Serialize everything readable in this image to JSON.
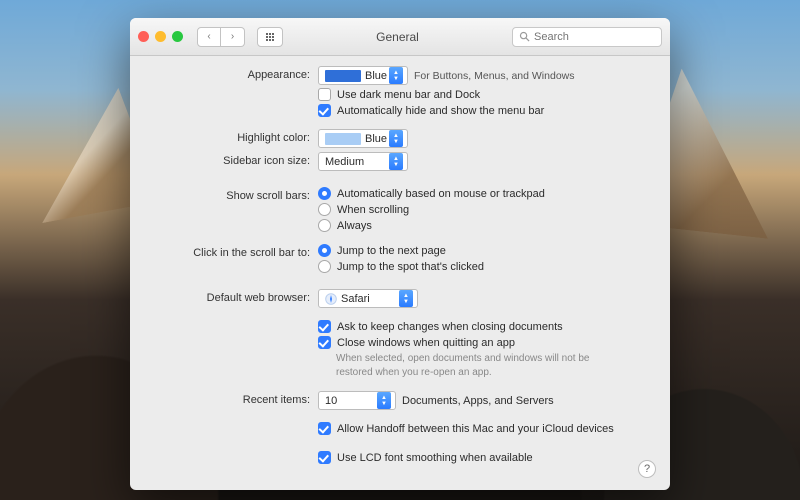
{
  "window": {
    "title": "General"
  },
  "search": {
    "placeholder": "Search"
  },
  "appearance": {
    "label": "Appearance:",
    "value": "Blue",
    "hint": "For Buttons, Menus, and Windows",
    "dark_menu": {
      "label": "Use dark menu bar and Dock",
      "checked": false
    },
    "autohide": {
      "label": "Automatically hide and show the menu bar",
      "checked": true
    }
  },
  "highlight": {
    "label": "Highlight color:",
    "value": "Blue"
  },
  "sidebar": {
    "label": "Sidebar icon size:",
    "value": "Medium"
  },
  "scrollbars": {
    "label": "Show scroll bars:",
    "options": [
      {
        "label": "Automatically based on mouse or trackpad",
        "checked": true
      },
      {
        "label": "When scrolling",
        "checked": false
      },
      {
        "label": "Always",
        "checked": false
      }
    ]
  },
  "click_scroll": {
    "label": "Click in the scroll bar to:",
    "options": [
      {
        "label": "Jump to the next page",
        "checked": true
      },
      {
        "label": "Jump to the spot that's clicked",
        "checked": false
      }
    ]
  },
  "browser": {
    "label": "Default web browser:",
    "value": "Safari",
    "icon_color": "#2f7bff"
  },
  "closing": {
    "ask": {
      "label": "Ask to keep changes when closing documents",
      "checked": true
    },
    "close_windows": {
      "label": "Close windows when quitting an app",
      "checked": true
    },
    "note": "When selected, open documents and windows will not be restored when you re-open an app."
  },
  "recent": {
    "label": "Recent items:",
    "value": "10",
    "suffix": "Documents, Apps, and Servers"
  },
  "handoff": {
    "label": "Allow Handoff between this Mac and your iCloud devices",
    "checked": true
  },
  "lcd": {
    "label": "Use LCD font smoothing when available",
    "checked": true
  },
  "help": {
    "label": "?"
  }
}
